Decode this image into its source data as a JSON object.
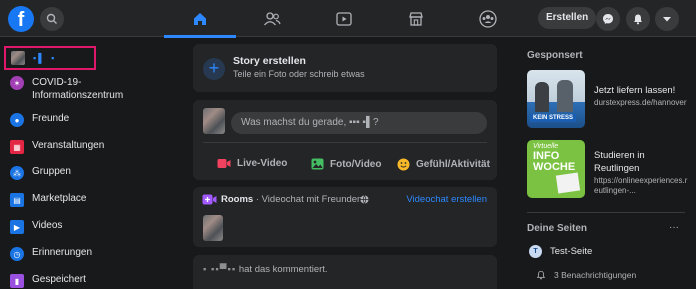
{
  "header": {
    "create_label": "Erstellen",
    "nav_tabs": [
      "home-icon",
      "friends-icon",
      "watch-icon",
      "marketplace-icon",
      "groups-icon"
    ]
  },
  "sidebar": {
    "profile_name": "▪▌ ▪",
    "items": [
      {
        "label": "COVID-19-Informationszentrum",
        "icon": "covid-icon",
        "color": "#a33fb5"
      },
      {
        "label": "Freunde",
        "icon": "friends-icon",
        "color": "#1b74e4"
      },
      {
        "label": "Veranstaltungen",
        "icon": "calendar-icon",
        "color": "#e42645"
      },
      {
        "label": "Gruppen",
        "icon": "groups-icon",
        "color": "#1b74e4"
      },
      {
        "label": "Marketplace",
        "icon": "marketplace-icon",
        "color": "#1b74e4"
      },
      {
        "label": "Videos",
        "icon": "video-icon",
        "color": "#1b74e4"
      },
      {
        "label": "Erinnerungen",
        "icon": "clock-icon",
        "color": "#1b74e4"
      },
      {
        "label": "Gespeichert",
        "icon": "bookmark-icon",
        "color": "#9b51e0"
      }
    ]
  },
  "story": {
    "title": "Story erstellen",
    "subtitle": "Teile ein Foto oder schreib etwas"
  },
  "composer": {
    "placeholder": "Was machst du gerade, ▪▪▪ ▪▌?",
    "live": "Live-Video",
    "photo": "Foto/Video",
    "feeling": "Gefühl/Aktivität"
  },
  "rooms": {
    "title": "Rooms",
    "subtitle": " · Videochat mit Freunden",
    "create": "Videochat erstellen"
  },
  "activity": {
    "name": "▪ ▪▪▀▪▪",
    "text": "hat das kommentiert."
  },
  "sponsored": {
    "heading": "Gesponsert",
    "ads": [
      {
        "title": "Jetzt liefern lassen!",
        "url": "durstexpress.de/hannover",
        "badge": "KEIN STRESS"
      },
      {
        "title": "Studieren in Reutlingen",
        "url": "https://onlineexperiences.reutlingen-...",
        "badge": "INFO WOCHE",
        "badge_top": "Virtuelle"
      }
    ]
  },
  "pages": {
    "heading": "Deine Seiten",
    "more": "···",
    "name": "Test-Seite",
    "avatar_letter": "T",
    "notifications": "3 Benachrichtigungen"
  },
  "colors": {
    "accent": "#2d88ff",
    "brand": "#1877f2",
    "highlight_border": "#e0186c"
  }
}
